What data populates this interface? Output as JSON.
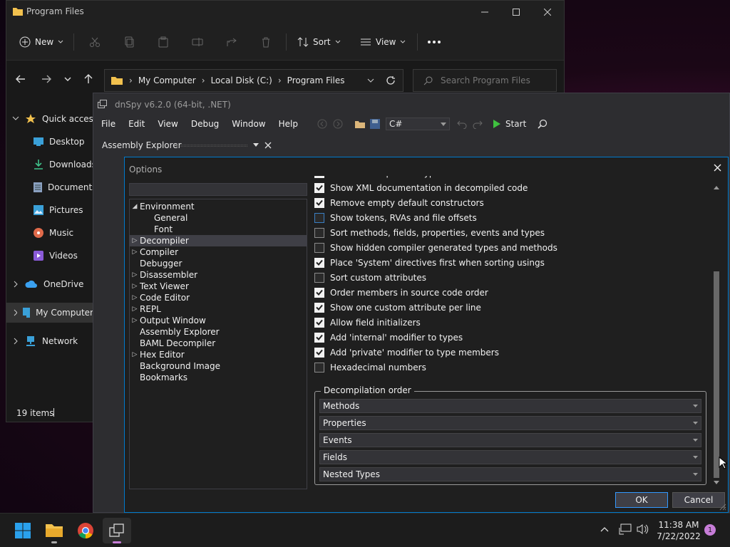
{
  "explorer": {
    "title": "Program Files",
    "toolbar": {
      "new_label": "New",
      "sort_label": "Sort",
      "view_label": "View"
    },
    "address": {
      "crumbs": [
        "My Computer",
        "Local Disk (C:)",
        "Program Files"
      ]
    },
    "search": {
      "placeholder": "Search Program Files"
    },
    "nav": [
      {
        "label": "Quick access"
      },
      {
        "label": "Desktop"
      },
      {
        "label": "Downloads"
      },
      {
        "label": "Documents"
      },
      {
        "label": "Pictures"
      },
      {
        "label": "Music"
      },
      {
        "label": "Videos"
      },
      {
        "label": "OneDrive"
      },
      {
        "label": "My Computer"
      },
      {
        "label": "Network"
      }
    ],
    "status": {
      "items": "19 items"
    }
  },
  "dnspy": {
    "title": "dnSpy v6.2.0 (64-bit, .NET)",
    "menu": [
      "File",
      "Edit",
      "View",
      "Debug",
      "Window",
      "Help"
    ],
    "language": "C#",
    "start_label": "Start",
    "assembly_explorer_tab": "Assembly Explorer"
  },
  "options": {
    "title": "Options",
    "filter_value": "",
    "tree": [
      {
        "label": "Environment"
      },
      {
        "label": "General"
      },
      {
        "label": "Font"
      },
      {
        "label": "Decompiler"
      },
      {
        "label": "Compiler"
      },
      {
        "label": "Debugger"
      },
      {
        "label": "Disassembler"
      },
      {
        "label": "Text Viewer"
      },
      {
        "label": "Code Editor"
      },
      {
        "label": "REPL"
      },
      {
        "label": "Output Window"
      },
      {
        "label": "Assembly Explorer"
      },
      {
        "label": "BAML Decompiler"
      },
      {
        "label": "Hex Editor"
      },
      {
        "label": "Background Image"
      },
      {
        "label": "Bookmarks"
      }
    ],
    "checks": [
      {
        "label": "Add a namespace to types with the same name",
        "checked": true
      },
      {
        "label": "Show XML documentation in decompiled code",
        "checked": true
      },
      {
        "label": "Remove empty default constructors",
        "checked": true
      },
      {
        "label": "Show tokens, RVAs and file offsets",
        "checked": false
      },
      {
        "label": "Sort methods, fields, properties, events and types",
        "checked": false
      },
      {
        "label": "Show hidden compiler generated types and methods",
        "checked": false
      },
      {
        "label": "Place 'System' directives first when sorting usings",
        "checked": true
      },
      {
        "label": "Sort custom attributes",
        "checked": false
      },
      {
        "label": "Order members in source code order",
        "checked": true
      },
      {
        "label": "Show one custom attribute per line",
        "checked": true
      },
      {
        "label": "Allow field initializers",
        "checked": true
      },
      {
        "label": "Add 'internal' modifier to types",
        "checked": true
      },
      {
        "label": "Add 'private' modifier to type members",
        "checked": true
      },
      {
        "label": "Hexadecimal numbers",
        "checked": false
      }
    ],
    "decompilation_order": {
      "legend": "Decompilation order",
      "items": [
        "Methods",
        "Properties",
        "Events",
        "Fields",
        "Nested Types"
      ]
    },
    "ok_label": "OK",
    "cancel_label": "Cancel"
  },
  "taskbar": {
    "time": "11:38 AM",
    "date": "7/22/2022",
    "notification_count": "1"
  },
  "colors": {
    "accent": "#007acc",
    "folder": "#f2c14e",
    "badge": "#c77dd8"
  }
}
